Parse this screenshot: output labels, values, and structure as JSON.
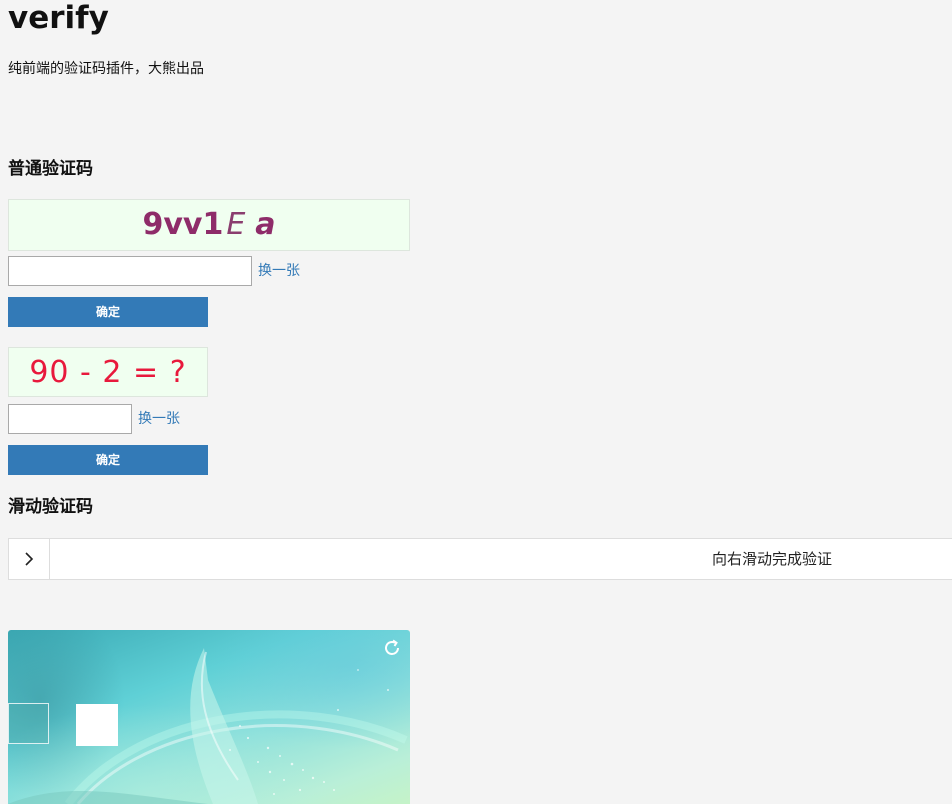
{
  "page": {
    "title": "verify",
    "subtitle": "纯前端的验证码插件，大熊出品"
  },
  "normal_captcha": {
    "section_title": "普通验证码",
    "code_chars": [
      "9",
      "v",
      "v",
      "1",
      "E",
      "a"
    ],
    "code_color": "#8e2c69",
    "background_color": "#f0fff0",
    "input_value": "",
    "refresh_label": "换一张",
    "confirm_label": "确定"
  },
  "math_captcha": {
    "expression": "90 - 2 = ?",
    "text_color": "#e8193c",
    "input_value": "",
    "refresh_label": "换一张",
    "confirm_label": "确定"
  },
  "slide_captcha": {
    "section_title": "滑动验证码",
    "hint_text": "向右滑动完成验证",
    "handle_icon": "chevron-right-icon"
  },
  "puzzle_captcha": {
    "refresh_icon": "refresh-icon"
  },
  "colors": {
    "accent": "#337ab7",
    "page_background": "#f4f4f4"
  }
}
